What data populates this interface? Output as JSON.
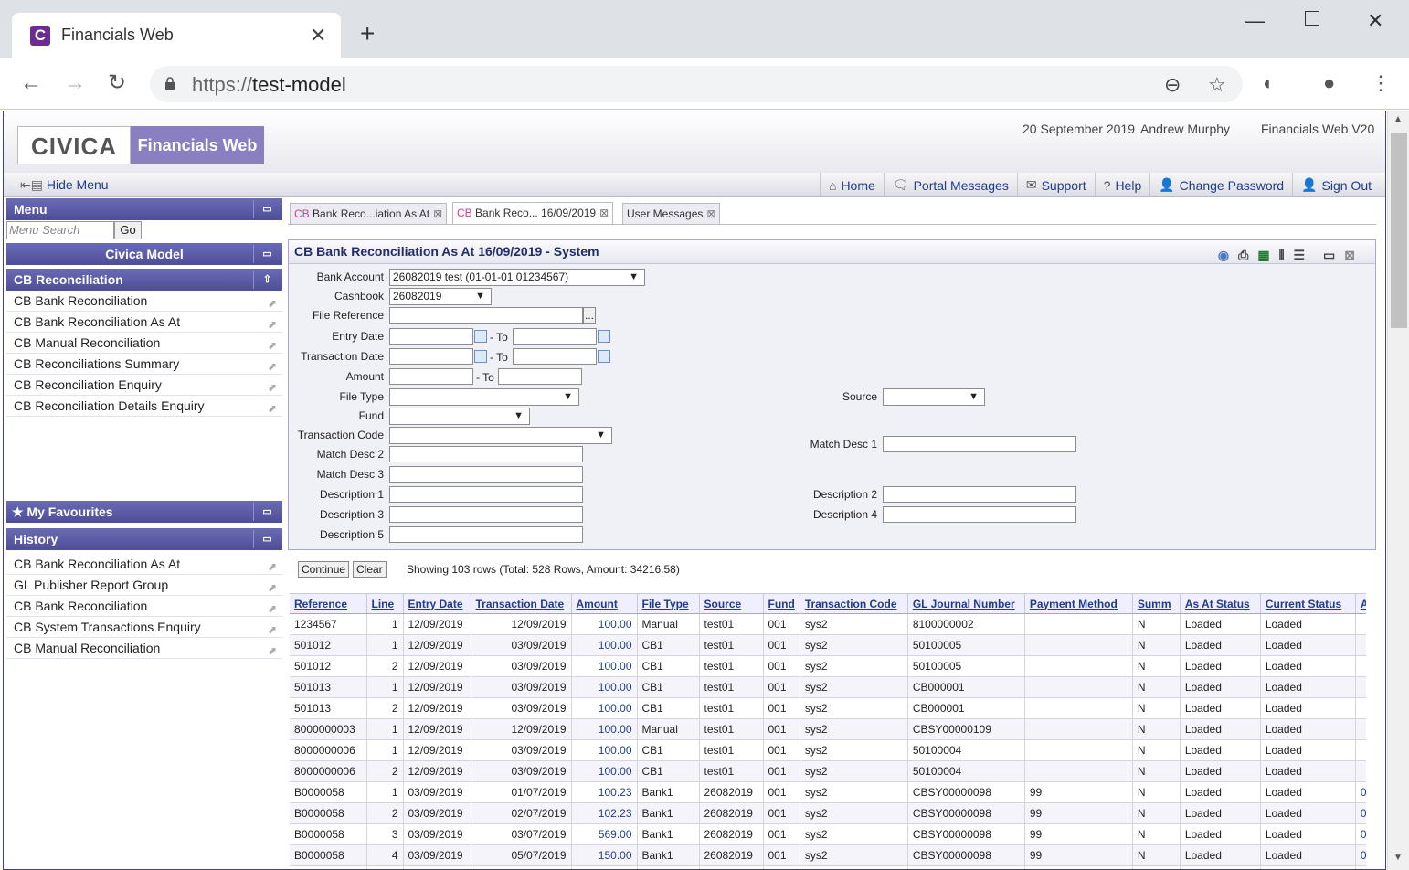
{
  "browser": {
    "tab_title": "Financials Web",
    "favicon": "C",
    "url_scheme": "https://",
    "url_host": "test-model"
  },
  "header": {
    "logo": "CIVICA",
    "app_name": "Financials Web",
    "date": "20 September 2019",
    "user": "Andrew Murphy",
    "version": "Financials Web V20"
  },
  "navbar": {
    "hide_menu": "Hide Menu",
    "links": [
      "Home",
      "Portal Messages",
      "Support",
      "Help",
      "Change Password",
      "Sign Out"
    ]
  },
  "sidebar": {
    "menu_title": "Menu",
    "search_placeholder": "Menu Search",
    "go_label": "Go",
    "model_title": "Civica Model",
    "section_title": "CB Reconciliation",
    "items": [
      "CB Bank Reconciliation",
      "CB Bank Reconciliation As At",
      "CB Manual Reconciliation",
      "CB Reconciliations Summary",
      "CB Reconciliation Enquiry",
      "CB Reconciliation Details Enquiry"
    ],
    "favourites_title": "My Favourites",
    "history_title": "History",
    "history": [
      "CB Bank Reconciliation As At",
      "GL Publisher Report Group",
      "CB Bank Reconciliation",
      "CB System Transactions Enquiry",
      "CB Manual Reconciliation"
    ]
  },
  "tabs": [
    {
      "prefix": "CB",
      "label": "Bank Reco...iation As At"
    },
    {
      "prefix": "CB",
      "label": "Bank Reco... 16/09/2019"
    },
    {
      "prefix": "",
      "label": "User Messages"
    }
  ],
  "panel": {
    "title": "CB Bank Reconciliation As At 16/09/2019 - System"
  },
  "form": {
    "bank_account_label": "Bank Account",
    "bank_account_value": "26082019 test (01-01-01 01234567)",
    "cashbook_label": "Cashbook",
    "cashbook_value": "26082019",
    "file_ref_label": "File Reference",
    "file_ref_btn": "...",
    "entry_date_label": "Entry Date",
    "transaction_date_label": "Transaction Date",
    "amount_label": "Amount",
    "to_label": "- To",
    "file_type_label": "File Type",
    "source_label": "Source",
    "fund_label": "Fund",
    "transaction_code_label": "Transaction Code",
    "match_desc1_label": "Match Desc 1",
    "match_desc2_label": "Match Desc 2",
    "match_desc3_label": "Match Desc 3",
    "desc1_label": "Description 1",
    "desc2_label": "Description 2",
    "desc3_label": "Description 3",
    "desc4_label": "Description 4",
    "desc5_label": "Description 5"
  },
  "actions": {
    "continue": "Continue",
    "clear": "Clear",
    "row_info": "Showing 103 rows (Total: 528 Rows, Amount: 34216.58)"
  },
  "table": {
    "columns": [
      "Reference",
      "Line",
      "Entry Date",
      "Transaction Date",
      "Amount",
      "File Type",
      "Source",
      "Fund",
      "Transaction Code",
      "GL Journal Number",
      "Payment Method",
      "Summ",
      "As At Status",
      "Current Status",
      "A"
    ],
    "rows": [
      [
        "1234567",
        "1",
        "12/09/2019",
        "12/09/2019",
        "100.00",
        "Manual",
        "test01",
        "001",
        "sys2",
        "8100000002",
        "",
        "N",
        "Loaded",
        "Loaded",
        ""
      ],
      [
        "501012",
        "1",
        "12/09/2019",
        "03/09/2019",
        "100.00",
        "CB1",
        "test01",
        "001",
        "sys2",
        "50100005",
        "",
        "N",
        "Loaded",
        "Loaded",
        ""
      ],
      [
        "501012",
        "2",
        "12/09/2019",
        "03/09/2019",
        "100.00",
        "CB1",
        "test01",
        "001",
        "sys2",
        "50100005",
        "",
        "N",
        "Loaded",
        "Loaded",
        ""
      ],
      [
        "501013",
        "1",
        "12/09/2019",
        "03/09/2019",
        "100.00",
        "CB1",
        "test01",
        "001",
        "sys2",
        "CB000001",
        "",
        "N",
        "Loaded",
        "Loaded",
        ""
      ],
      [
        "501013",
        "2",
        "12/09/2019",
        "03/09/2019",
        "100.00",
        "CB1",
        "test01",
        "001",
        "sys2",
        "CB000001",
        "",
        "N",
        "Loaded",
        "Loaded",
        ""
      ],
      [
        "8000000003",
        "1",
        "12/09/2019",
        "12/09/2019",
        "100.00",
        "Manual",
        "test01",
        "001",
        "sys2",
        "CBSY00000109",
        "",
        "N",
        "Loaded",
        "Loaded",
        ""
      ],
      [
        "8000000006",
        "1",
        "12/09/2019",
        "03/09/2019",
        "100.00",
        "CB1",
        "test01",
        "001",
        "sys2",
        "50100004",
        "",
        "N",
        "Loaded",
        "Loaded",
        ""
      ],
      [
        "8000000006",
        "2",
        "12/09/2019",
        "03/09/2019",
        "100.00",
        "CB1",
        "test01",
        "001",
        "sys2",
        "50100004",
        "",
        "N",
        "Loaded",
        "Loaded",
        ""
      ],
      [
        "B0000058",
        "1",
        "03/09/2019",
        "01/07/2019",
        "100.23",
        "Bank1",
        "26082019",
        "001",
        "sys2",
        "CBSY00000098",
        "99",
        "N",
        "Loaded",
        "Loaded",
        "0"
      ],
      [
        "B0000058",
        "2",
        "03/09/2019",
        "02/07/2019",
        "102.23",
        "Bank1",
        "26082019",
        "001",
        "sys2",
        "CBSY00000098",
        "99",
        "N",
        "Loaded",
        "Loaded",
        "0"
      ],
      [
        "B0000058",
        "3",
        "03/09/2019",
        "03/07/2019",
        "569.00",
        "Bank1",
        "26082019",
        "001",
        "sys2",
        "CBSY00000098",
        "99",
        "N",
        "Loaded",
        "Loaded",
        "0"
      ],
      [
        "B0000058",
        "4",
        "03/09/2019",
        "05/07/2019",
        "150.00",
        "Bank1",
        "26082019",
        "001",
        "sys2",
        "CBSY00000098",
        "99",
        "N",
        "Loaded",
        "Loaded",
        "0"
      ],
      [
        "",
        "",
        "",
        "",
        "",
        "",
        "",
        "",
        "",
        "",
        "",
        "",
        "",
        "",
        ""
      ]
    ]
  }
}
